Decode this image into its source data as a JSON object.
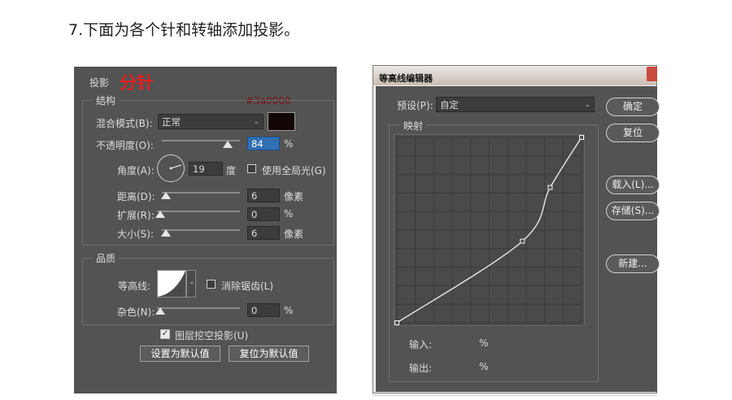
{
  "heading": "7.下面为各个针和转轴添加投影。",
  "left_panel": {
    "title": "投影",
    "annotation_red": "分针",
    "annotation_color": "#3a0000",
    "structure": {
      "legend": "结构",
      "blend_mode_label": "混合模式(B):",
      "blend_mode_value": "正常",
      "shadow_color": "#120606",
      "opacity_label": "不透明度(O):",
      "opacity_value": "84",
      "opacity_unit": "%",
      "opacity_level": 0.84,
      "angle_label": "角度(A):",
      "angle_value": "19",
      "angle_unit": "度",
      "global_light_label": "使用全局光(G)",
      "global_light_checked": false,
      "distance_label": "距离(D):",
      "distance_value": "6",
      "distance_unit": "像素",
      "spread_label": "扩展(R):",
      "spread_value": "0",
      "spread_unit": "%",
      "size_label": "大小(S):",
      "size_value": "6",
      "size_unit": "像素"
    },
    "quality": {
      "legend": "品质",
      "contour_label": "等高线:",
      "antialias_label": "消除锯齿(L)",
      "antialias_checked": false,
      "noise_label": "杂色(N):",
      "noise_value": "0",
      "noise_unit": "%"
    },
    "knockout_label": "图层挖空投影(U)",
    "knockout_checked": true,
    "make_default_label": "设置为默认值",
    "reset_default_label": "复位为默认值"
  },
  "contour_editor": {
    "title": "等高线编辑器",
    "preset_label": "预设(P):",
    "preset_value": "自定",
    "mapping_legend": "映射",
    "input_label": "输入:",
    "input_unit": "%",
    "output_label": "输出:",
    "output_unit": "%",
    "ok_label": "确定",
    "reset_label": "复位",
    "load_label": "载入(L)...",
    "save_label": "存储(S)...",
    "new_label": "新建...",
    "curve_points": [
      [
        0,
        0
      ],
      [
        0.68,
        0.44
      ],
      [
        0.83,
        0.73
      ],
      [
        1,
        1
      ]
    ]
  }
}
